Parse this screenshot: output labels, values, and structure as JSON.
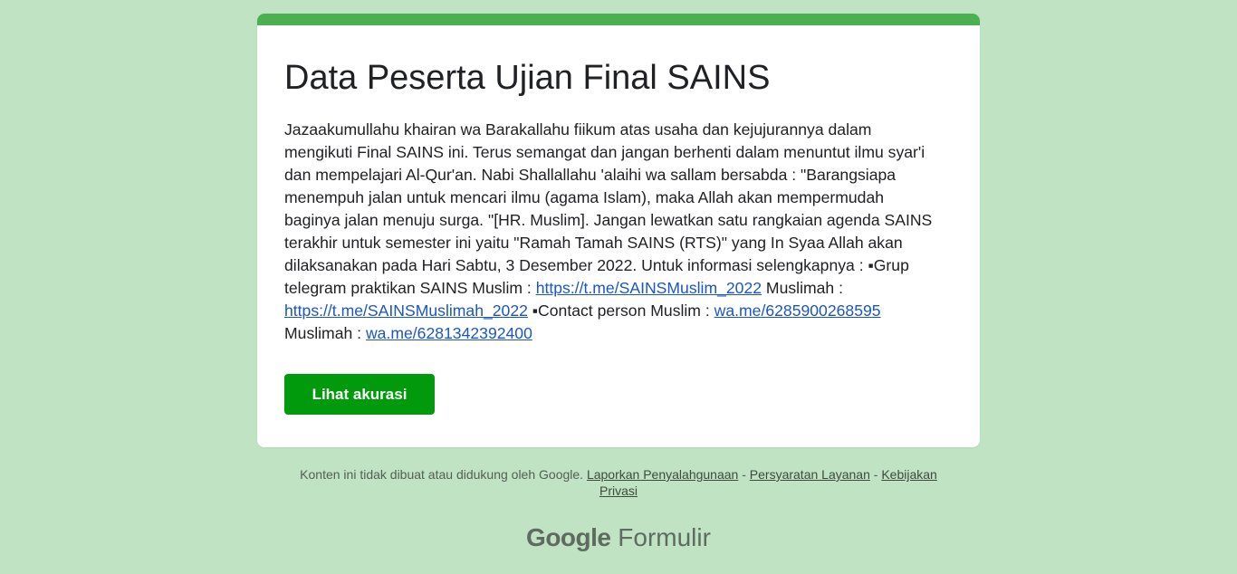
{
  "form": {
    "title": "Data Peserta Ujian Final SAINS",
    "description": {
      "line1": "Jazaakumullahu khairan wa Barakallahu fiikum atas usaha dan kejujurannya dalam",
      "line2": "mengikuti Final SAINS ini. Terus semangat dan jangan berhenti dalam menuntut ilmu syar'i",
      "line3": "dan mempelajari Al-Qur'an. Nabi Shallallahu 'alaihi wa sallam bersabda : \"Barangsiapa",
      "line4": "menempuh jalan untuk mencari ilmu (agama Islam), maka Allah akan mempermudah",
      "line5": "baginya jalan menuju surga. \"[HR. Muslim].  Jangan lewatkan satu rangkaian agenda SAINS",
      "line6": "terakhir untuk semester ini yaitu \"Ramah Tamah SAINS (RTS)\" yang In Syaa Allah akan",
      "line7": "dilaksanakan pada Hari Sabtu, 3 Desember 2022.  Untuk informasi selengkapnya : ▪Grup",
      "line8_prefix": "telegram praktikan SAINS  Muslim : ",
      "link_muslim": "https://t.me/SAINSMuslim_2022",
      "line8_suffix": " Muslimah :",
      "link_muslimah": "https://t.me/SAINSMuslimah_2022",
      "line9_middle": " ▪Contact person  Muslim : ",
      "link_wa_muslim": "wa.me/6285900268595",
      "line10_prefix": "Muslimah : ",
      "link_wa_muslimah": "wa.me/6281342392400"
    },
    "button_label": "Lihat akurasi"
  },
  "footer": {
    "disclaimer": "Konten ini tidak dibuat atau didukung oleh Google. ",
    "report_link": "Laporkan Penyalahgunaan",
    "sep1": " - ",
    "terms_link": "Persyaratan Layanan",
    "sep2": " - ",
    "privacy_link_part1": "Kebijakan",
    "privacy_link_part2": "Privasi"
  },
  "brand": {
    "google": "Google",
    "product": " Formulir"
  },
  "colors": {
    "background": "#c0e3c4",
    "accent_bar": "#4caf50",
    "button": "#009a0c",
    "link": "#1a56c4"
  }
}
